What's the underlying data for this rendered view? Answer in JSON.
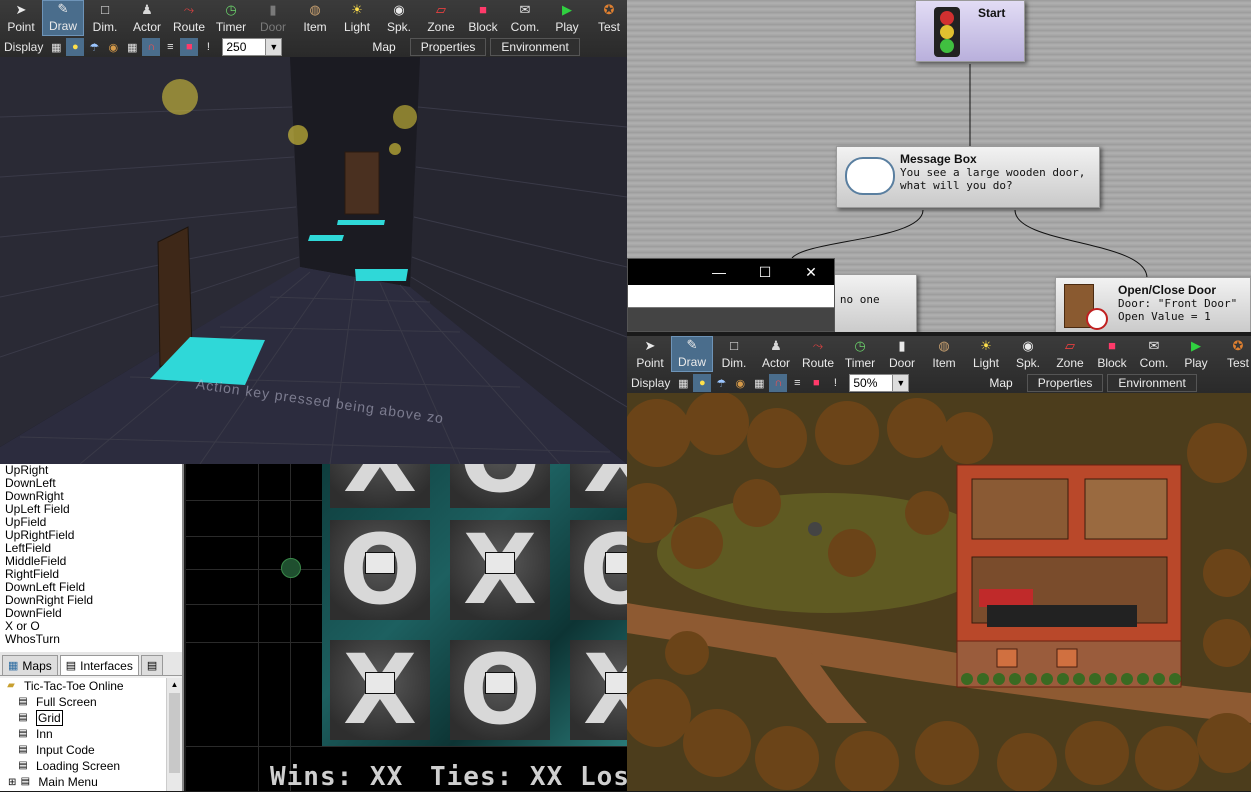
{
  "top_toolbar": {
    "tools": [
      {
        "label": "Point",
        "icon": "cursor-icon"
      },
      {
        "label": "Draw",
        "icon": "pencil-icon",
        "active": true
      },
      {
        "label": "Dim.",
        "icon": "square-icon"
      },
      {
        "label": "Actor",
        "icon": "actor-icon"
      },
      {
        "label": "Route",
        "icon": "route-icon"
      },
      {
        "label": "Timer",
        "icon": "timer-icon"
      },
      {
        "label": "Door",
        "icon": "door-icon",
        "disabled": true
      },
      {
        "label": "Item",
        "icon": "bag-icon"
      },
      {
        "label": "Light",
        "icon": "bulb-icon"
      },
      {
        "label": "Spk.",
        "icon": "speaker-icon"
      },
      {
        "label": "Zone",
        "icon": "zone-icon"
      },
      {
        "label": "Block",
        "icon": "block-icon"
      },
      {
        "label": "Com.",
        "icon": "comment-icon"
      },
      {
        "label": "Play",
        "icon": "play-icon"
      },
      {
        "label": "Test",
        "icon": "test-icon"
      }
    ],
    "display_label": "Display",
    "zoom_value": "250",
    "tabs": [
      "Map",
      "Properties",
      "Environment"
    ]
  },
  "map_toolbar": {
    "tools": [
      {
        "label": "Point",
        "icon": "cursor-icon"
      },
      {
        "label": "Draw",
        "icon": "pencil-icon",
        "active": true
      },
      {
        "label": "Dim.",
        "icon": "square-icon"
      },
      {
        "label": "Actor",
        "icon": "actor-icon"
      },
      {
        "label": "Route",
        "icon": "route-icon"
      },
      {
        "label": "Timer",
        "icon": "timer-icon"
      },
      {
        "label": "Door",
        "icon": "door-icon"
      },
      {
        "label": "Item",
        "icon": "bag-icon"
      },
      {
        "label": "Light",
        "icon": "bulb-icon"
      },
      {
        "label": "Spk.",
        "icon": "speaker-icon"
      },
      {
        "label": "Zone",
        "icon": "zone-icon"
      },
      {
        "label": "Block",
        "icon": "block-icon"
      },
      {
        "label": "Com.",
        "icon": "comment-icon"
      },
      {
        "label": "Play",
        "icon": "play-icon"
      },
      {
        "label": "Test",
        "icon": "test-icon"
      }
    ],
    "display_label": "Display",
    "zoom_value": "50%",
    "tabs": [
      "Map",
      "Properties",
      "Environment"
    ]
  },
  "dungeon": {
    "overlay_text": "Action key pressed being above zo"
  },
  "event_editor": {
    "start_node": {
      "title": "Start"
    },
    "message_node": {
      "title": "Message Box",
      "line1": "You see a large wooden door,",
      "line2": "what will you do?"
    },
    "partial_node": {
      "text": "r, no one"
    },
    "door_node": {
      "title": "Open/Close Door",
      "line1": "Door: \"Front Door\"",
      "line2": "Open Value = 1"
    }
  },
  "window_controls": {
    "minimize": "—",
    "maximize": "☐",
    "close": "✕"
  },
  "event_list": {
    "items": [
      "UpRight",
      "DownLeft",
      "DownRight",
      "UpLeft Field",
      "UpField",
      "UpRightField",
      "LeftField",
      "MiddleField",
      "RightField",
      "DownLeft Field",
      "DownRight Field",
      "DownField",
      "X or O",
      "WhosTurn"
    ]
  },
  "panel_tabs": {
    "maps": "Maps",
    "interfaces": "Interfaces"
  },
  "tree": {
    "root": "Tic-Tac-Toe Online",
    "items": [
      "Full Screen",
      "Grid",
      "Inn",
      "Input Code",
      "Loading Screen",
      "Main Menu"
    ],
    "selected": "Grid"
  },
  "tictactoe": {
    "cells": [
      "X",
      "O",
      "X",
      "O",
      "X",
      "O",
      "X",
      "O",
      "X"
    ],
    "wins": "Wins: XX",
    "ties": "Ties: XX",
    "losses": "Los"
  },
  "colors": {
    "toolbar": "#2e2e2e",
    "active_tool": "#4a6d8c",
    "board": "#1d6060"
  }
}
